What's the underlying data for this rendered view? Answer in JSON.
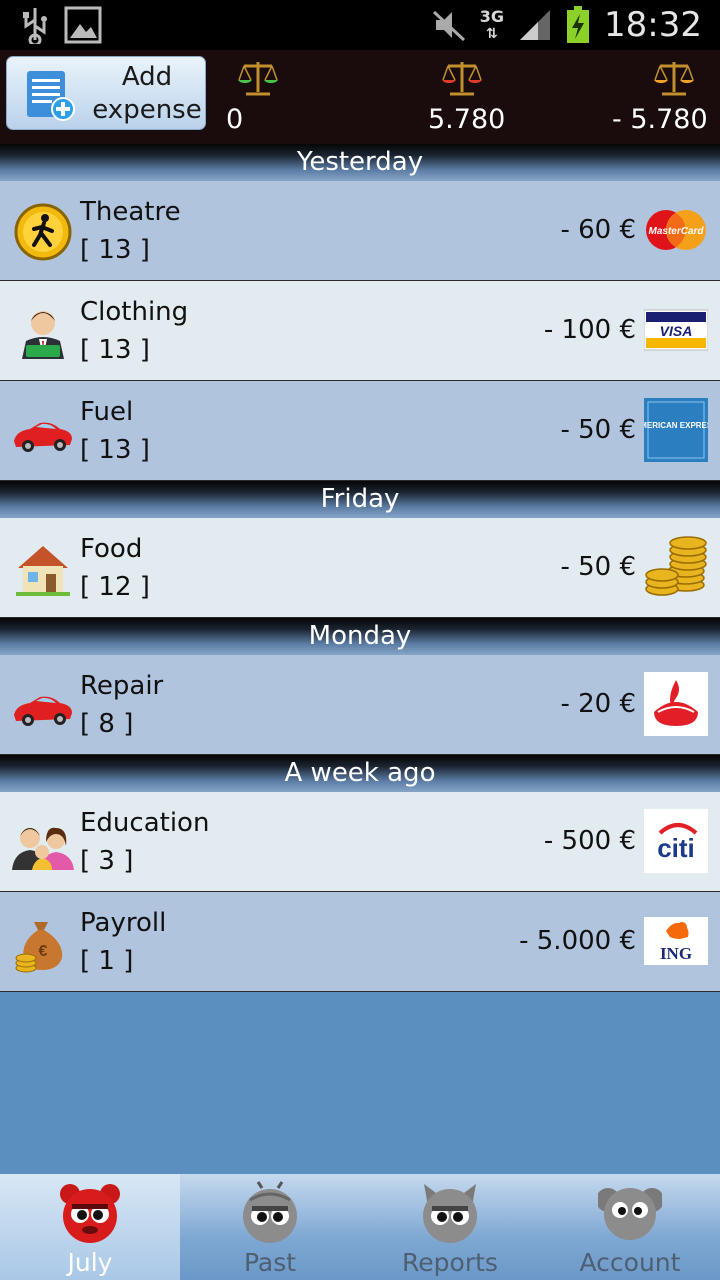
{
  "status_bar": {
    "time": "18:32",
    "network": "3G",
    "icons": [
      "usb-icon",
      "image-icon",
      "mute-icon",
      "signal-icon",
      "battery-charging-icon"
    ]
  },
  "header": {
    "add_button_label": "Add expense",
    "balances": [
      {
        "icon": "scale-green-icon",
        "value": "0"
      },
      {
        "icon": "scale-red-icon",
        "value": "5.780"
      },
      {
        "icon": "scale-orange-icon",
        "value": "- 5.780"
      }
    ]
  },
  "sections": [
    {
      "title": "Yesterday",
      "items": [
        {
          "name": "Theatre",
          "count": "[ 13 ]",
          "amount": "- 60 €",
          "category_icon": "theatre-icon",
          "payment_icon": "mastercard-icon",
          "payment_label": "MasterCard"
        },
        {
          "name": "Clothing",
          "count": "[ 13 ]",
          "amount": "- 100 €",
          "category_icon": "businessman-icon",
          "payment_icon": "visa-icon",
          "payment_label": "VISA"
        },
        {
          "name": "Fuel",
          "count": "[ 13 ]",
          "amount": "- 50 €",
          "category_icon": "car-icon",
          "payment_icon": "amex-icon",
          "payment_label": "AMERICAN EXPRESS"
        }
      ]
    },
    {
      "title": "Friday",
      "items": [
        {
          "name": "Food",
          "count": "[ 12 ]",
          "amount": "- 50 €",
          "category_icon": "house-icon",
          "payment_icon": "coins-icon",
          "payment_label": ""
        }
      ]
    },
    {
      "title": "Monday",
      "items": [
        {
          "name": "Repair",
          "count": "[ 8 ]",
          "amount": "- 20 €",
          "category_icon": "car-icon",
          "payment_icon": "santander-icon",
          "payment_label": ""
        }
      ]
    },
    {
      "title": "A week ago",
      "items": [
        {
          "name": "Education",
          "count": "[ 3 ]",
          "amount": "- 500 €",
          "category_icon": "family-icon",
          "payment_icon": "citi-icon",
          "payment_label": "citi"
        },
        {
          "name": "Payroll",
          "count": "[ 1 ]",
          "amount": "- 5.000 €",
          "category_icon": "money-bag-icon",
          "payment_icon": "ing-icon",
          "payment_label": "ING"
        }
      ]
    }
  ],
  "nav": {
    "tabs": [
      {
        "label": "July",
        "icon": "red-bear-icon",
        "active": true
      },
      {
        "label": "Past",
        "icon": "gray-bug-icon",
        "active": false
      },
      {
        "label": "Reports",
        "icon": "gray-cat-icon",
        "active": false
      },
      {
        "label": "Account",
        "icon": "gray-elephant-icon",
        "active": false
      }
    ]
  },
  "colors": {
    "header_bg": "#1a0c0c",
    "row_blue": "#b0c4de",
    "row_light": "#e2ebf0",
    "content_bg": "#5b8fbf",
    "nav_active_label": "#ffffff"
  }
}
